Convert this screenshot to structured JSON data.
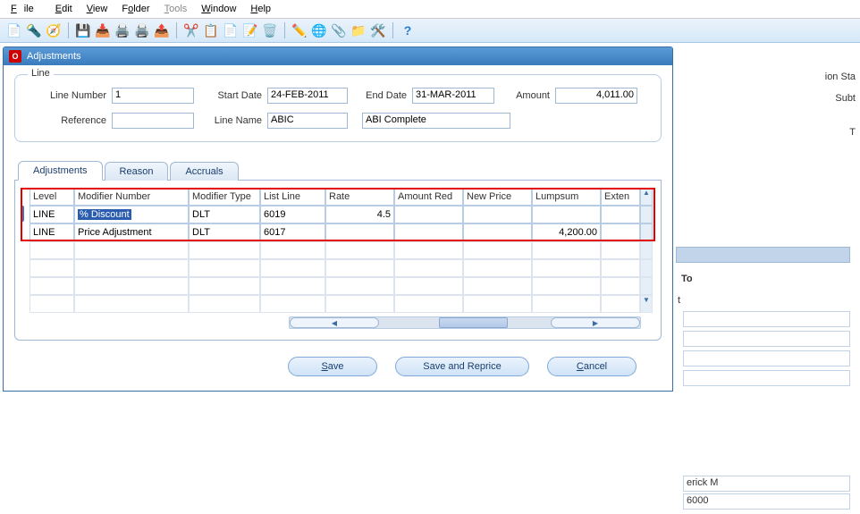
{
  "menu": {
    "file": "File",
    "edit": "Edit",
    "view": "View",
    "folder": "Folder",
    "tools": "Tools",
    "window": "Window",
    "help": "Help"
  },
  "window": {
    "title": "Adjustments"
  },
  "line_group": {
    "legend": "Line",
    "line_number_label": "Line Number",
    "line_number": "1",
    "start_date_label": "Start Date",
    "start_date": "24-FEB-2011",
    "end_date_label": "End Date",
    "end_date": "31-MAR-2011",
    "amount_label": "Amount",
    "amount": "4,011.00",
    "reference_label": "Reference",
    "reference": "",
    "line_name_label": "Line Name",
    "line_name": "ABIC",
    "line_desc": "ABI Complete"
  },
  "tabs": {
    "adjustments": "Adjustments",
    "reason": "Reason",
    "accruals": "Accruals"
  },
  "grid": {
    "headers": {
      "level": "Level",
      "modifier_number": "Modifier Number",
      "modifier_type": "Modifier Type",
      "list_line": "List Line",
      "rate": "Rate",
      "amount_red": "Amount Red",
      "new_price": "New Price",
      "lumpsum": "Lumpsum",
      "exten": "Exten"
    },
    "rows": [
      {
        "level": "LINE",
        "modifier_number": "% Discount",
        "modifier_type": "DLT",
        "list_line": "6019",
        "rate": "4.5",
        "amount_red": "",
        "new_price": "",
        "lumpsum": "",
        "exten": ""
      },
      {
        "level": "LINE",
        "modifier_number": "Price Adjustment",
        "modifier_type": "DLT",
        "list_line": "6017",
        "rate": "",
        "amount_red": "",
        "new_price": "",
        "lumpsum": "4,200.00",
        "exten": ""
      }
    ]
  },
  "buttons": {
    "save": "Save",
    "save_reprice": "Save and Reprice",
    "cancel": "Cancel"
  },
  "bg": {
    "ion_state": "ion Sta",
    "subt": "Subt",
    "t": "T",
    "to": "To",
    "t2": "t",
    "erick": "erick M",
    "num": "6000"
  }
}
